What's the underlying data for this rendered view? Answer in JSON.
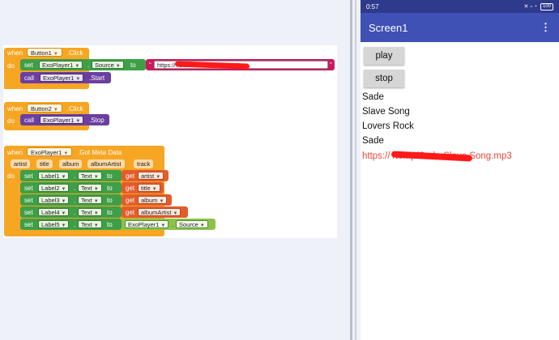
{
  "workspace": {
    "block1": {
      "when": "when",
      "component": "Button1",
      "event": ".Click",
      "do": "do",
      "set": "set",
      "set_component": "ExoPlayer1",
      "set_property": "Source",
      "to": "to",
      "text_value": "https://                         /Sade-Slave Song.mp3",
      "call": "call",
      "call_component": "ExoPlayer1",
      "call_method": ".Start"
    },
    "block2": {
      "when": "when",
      "component": "Button2",
      "event": ".Click",
      "do": "do",
      "call": "call",
      "call_component": "ExoPlayer1",
      "call_method": ".Stop"
    },
    "block3": {
      "when": "when",
      "component": "ExoPlayer1",
      "event": ".Got Meta Data",
      "params": [
        "artist",
        "title",
        "album",
        "albumArtist",
        "track"
      ],
      "do": "do",
      "rows": [
        {
          "set": "set",
          "label": "Label1",
          "prop": "Text",
          "to": "to",
          "get": "get",
          "value": "artist"
        },
        {
          "set": "set",
          "label": "Label2",
          "prop": "Text",
          "to": "to",
          "get": "get",
          "value": "title"
        },
        {
          "set": "set",
          "label": "Label3",
          "prop": "Text",
          "to": "to",
          "get": "get",
          "value": "album"
        },
        {
          "set": "set",
          "label": "Label4",
          "prop": "Text",
          "to": "to",
          "get": "get",
          "value": "albumArtist"
        }
      ],
      "row5": {
        "set": "set",
        "label": "Label5",
        "prop": "Text",
        "to": "to",
        "component": "ExoPlayer1",
        "property": "Source"
      }
    }
  },
  "phone": {
    "time": "0:57",
    "status_icons": "✕ ▫ ◔",
    "battery": "100",
    "title": "Screen1",
    "menu_icon": "⋮",
    "play_label": "play",
    "stop_label": "stop",
    "label1": "Sade",
    "label2": "Slave Song",
    "label3": "Lovers Rock",
    "label4": "Sade",
    "label5": "https://                              /temp/Sade-Slave Song.mp3"
  },
  "colors": {
    "event_block": "#f6a623",
    "setter_block": "#3f9f47",
    "call_block": "#6b3fa0",
    "getter_block": "#e35d2b",
    "text_block": "#c8195e",
    "appbar": "#3f51b5",
    "statusbar": "#2e3a8c",
    "link_text": "#e5483a"
  }
}
